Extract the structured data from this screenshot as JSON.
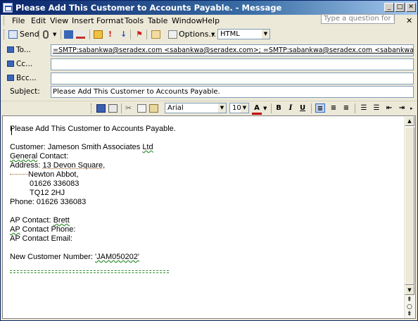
{
  "window": {
    "title": "Please Add This Customer to Accounts Payable. - Message",
    "controls": {
      "minimize": "_",
      "restore": "□",
      "close": "✕"
    }
  },
  "menu": {
    "items": [
      "File",
      "Edit",
      "View",
      "Insert",
      "Format",
      "Tools",
      "Table",
      "Window",
      "Help"
    ],
    "help_placeholder": "Type a question for help",
    "close_glyph": "✕"
  },
  "toolbar": {
    "send_label": "Send",
    "options_label": "Options...",
    "format_value": "HTML"
  },
  "header": {
    "to_label": "To...",
    "cc_label": "Cc...",
    "bcc_label": "Bcc...",
    "subject_label": "Subject:",
    "to_value": "=SMTP:sabankwa@seradex.com <sabankwa@seradex.com>; =SMTP:sabankwa@seradex.com <sabankwa@seradex.com>",
    "cc_value": "",
    "bcc_value": "",
    "subject_value": "Please Add This Customer to Accounts Payable."
  },
  "format_toolbar": {
    "font": "Arial",
    "size": "10",
    "bold": "B",
    "italic": "I",
    "underline": "U",
    "font_color": "A"
  },
  "message": {
    "heading": "Please Add This Customer to Accounts Payable.",
    "customer_label": "Customer: ",
    "customer_name_a": "Jameson Smith Associates ",
    "customer_name_b": "Ltd",
    "general_contact_a": "General",
    "general_contact_b": " Contact:",
    "address_label": "Address: ",
    "address_1": "13 Devon Square,",
    "address_2": "Newton Abbot,",
    "address_3": "01626 336083",
    "address_4": "TQ12 2HJ",
    "phone": "Phone: 01626 336083",
    "ap_contact_label": "AP Contact: ",
    "ap_contact_name": "Brett",
    "ap_phone_a": "AP",
    "ap_phone_b": " Contact Phone:",
    "ap_email": "AP Contact Email:",
    "new_customer_label": "New Customer Number: ",
    "new_customer_value": "'JAM050202'"
  }
}
